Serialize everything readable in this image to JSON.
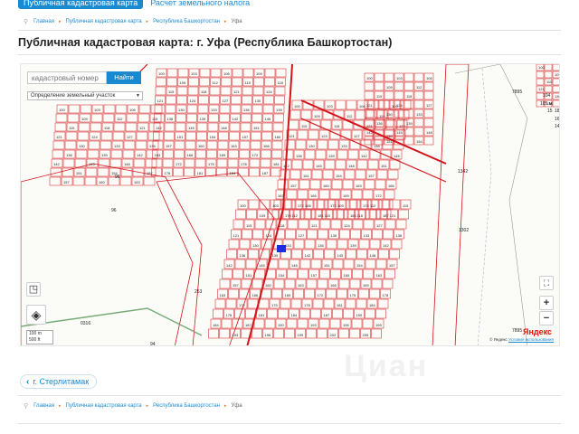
{
  "tabs": {
    "active": "Публичная кадастровая карта",
    "other": "Расчет земельного налога"
  },
  "breadcrumb": {
    "items": [
      "Главная",
      "Публичная кадастровая карта",
      "Республика Башкортостан"
    ],
    "current": "Уфа"
  },
  "page_title": "Публичная кадастровая карта: г. Уфа (Республика Башкортостан)",
  "map": {
    "search_placeholder": "кадастровый номер",
    "search_button": "Найти",
    "mode_select": "Определение земельный участок",
    "scale": [
      "100 m",
      "500 ft"
    ],
    "logo": "Яндекс",
    "copyright": "© Яндекс",
    "terms": "Условия использования",
    "labels": [
      "96",
      "96",
      "253",
      "0316",
      "94",
      "7895",
      "7895",
      "1342",
      "1302",
      "104",
      "105 м",
      "15",
      "18",
      "16",
      "14"
    ]
  },
  "nav": {
    "prev_label": "г. Стерлитамак"
  },
  "watermark": "Циан",
  "colors": {
    "accent": "#1a8ad0",
    "parcel_red": "#d3141a",
    "separator_orange": "#e07d2a"
  }
}
